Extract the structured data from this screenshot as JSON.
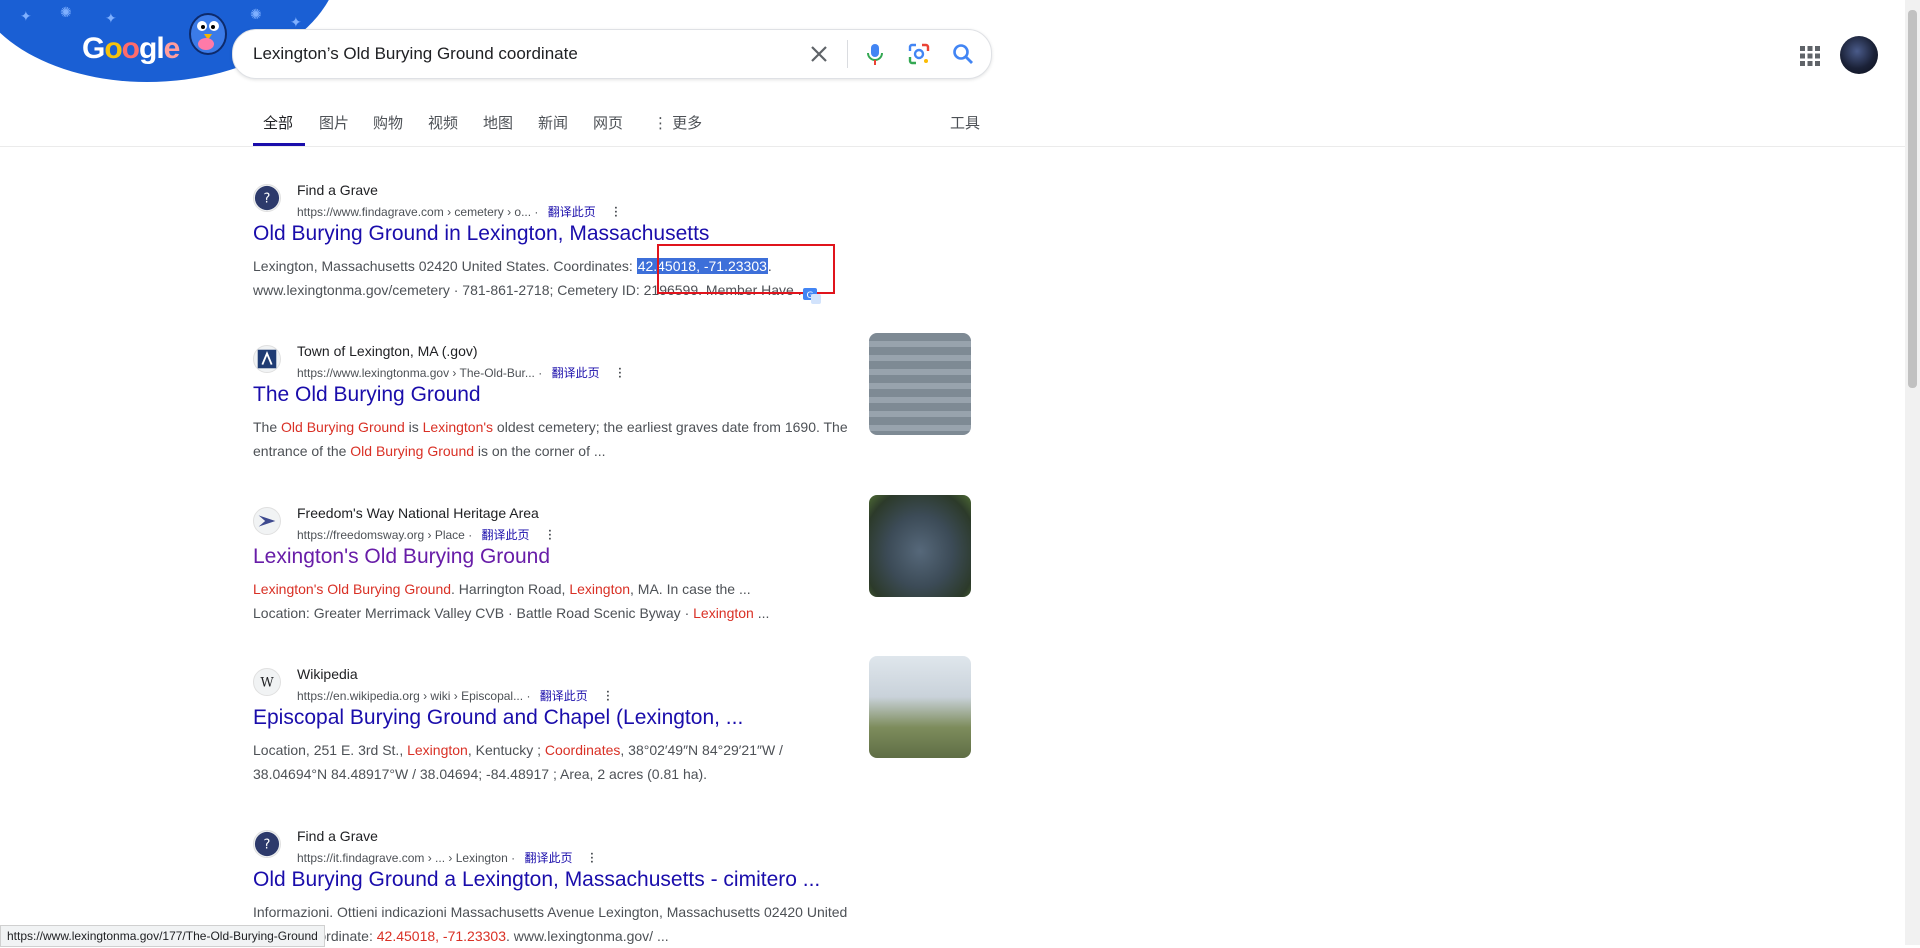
{
  "header": {
    "logo_text": "Google",
    "search_query": "Lexington’s Old Burying Ground coordinate"
  },
  "tabs": {
    "items": [
      "全部",
      "图片",
      "购物",
      "视频",
      "地图",
      "新闻",
      "网页",
      "⋮ 更多"
    ],
    "active": "全部",
    "tools": "工具"
  },
  "results": [
    {
      "site_name": "Find a Grave",
      "url": "https://www.findagrave.com › cemetery › o...",
      "translate": "翻译此页",
      "title": "Old Burying Ground in Lexington, Massachusetts",
      "snippet_line1_pre": "Lexington, Massachusetts 02420 United States. Coordinates: ",
      "snippet_selected": "42.45018, -71.23303",
      "snippet_line1_post": ".",
      "snippet_line2": "www.lexingtonma.gov/cemetery · 781-861-2718; Cemetery ID: 2196599. Member Have ..."
    },
    {
      "site_name": "Town of Lexington, MA (.gov)",
      "url": "https://www.lexingtonma.gov › The-Old-Bur...",
      "translate": "翻译此页",
      "title": "The Old Burying Ground",
      "s_a": "The ",
      "s_b": "Old Burying Ground",
      "s_c": " is ",
      "s_d": "Lexington's",
      "s_e": " oldest cemetery; the earliest graves date from 1690. The entrance of the ",
      "s_f": "Old Burying Ground",
      "s_g": " is on the corner of ..."
    },
    {
      "site_name": "Freedom's Way National Heritage Area",
      "url": "https://freedomsway.org › Place",
      "translate": "翻译此页",
      "title": "Lexington's Old Burying Ground",
      "s_a": "Lexington's Old Burying Ground",
      "s_b": ". Harrington Road, ",
      "s_c": "Lexington",
      "s_d": ", MA. In case the ...",
      "s_e": "Location: Greater Merrimack Valley CVB · Battle Road Scenic Byway · ",
      "s_f": "Lexington",
      "s_g": " ..."
    },
    {
      "site_name": "Wikipedia",
      "url": "https://en.wikipedia.org › wiki › Episcopal...",
      "translate": "翻译此页",
      "title": "Episcopal Burying Ground and Chapel (Lexington, ...",
      "s_a": "Location, 251 E. 3rd St., ",
      "s_b": "Lexington",
      "s_c": ", Kentucky ; ",
      "s_d": "Coordinates",
      "s_e": ", 38°02′49″N 84°29′21″W / 38.04694°N 84.48917°W / 38.04694; -84.48917 ; Area, 2 acres (0.81 ha)."
    },
    {
      "site_name": "Find a Grave",
      "url": "https://it.findagrave.com › ... › Lexington",
      "translate": "翻译此页",
      "title": "Old Burying Ground a Lexington, Massachusetts - cimitero ...",
      "s_a": "Informazioni. Ottieni indicazioni Massachusetts Avenue Lexington, Massachusetts 02420 United",
      "s_b": "States. Coordinate: ",
      "s_c": "42.45018, -71.23303",
      "s_d": ". www.lexingtonma.gov/ ..."
    }
  ],
  "status_bar": "https://www.lexingtonma.gov/177/The-Old-Burying-Ground"
}
